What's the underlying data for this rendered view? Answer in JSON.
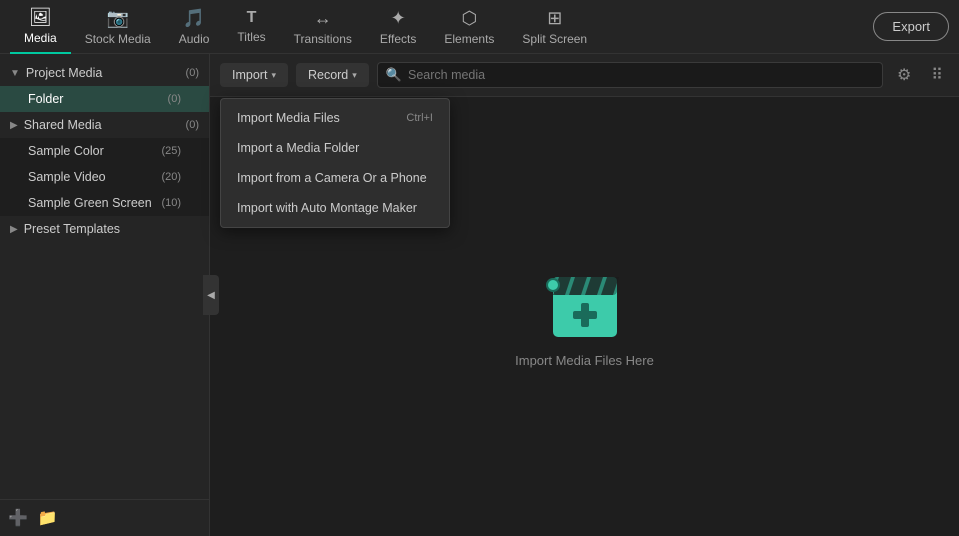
{
  "topNav": {
    "items": [
      {
        "id": "media",
        "label": "Media",
        "icon": "🖼",
        "active": true
      },
      {
        "id": "stock-media",
        "label": "Stock Media",
        "icon": "📷"
      },
      {
        "id": "audio",
        "label": "Audio",
        "icon": "🎵"
      },
      {
        "id": "titles",
        "label": "Titles",
        "icon": "T"
      },
      {
        "id": "transitions",
        "label": "Transitions",
        "icon": "↔"
      },
      {
        "id": "effects",
        "label": "Effects",
        "icon": "✦"
      },
      {
        "id": "elements",
        "label": "Elements",
        "icon": "⬡"
      },
      {
        "id": "split-screen",
        "label": "Split Screen",
        "icon": "⊞"
      }
    ],
    "export_label": "Export"
  },
  "sidebar": {
    "sections": [
      {
        "id": "project-media",
        "label": "Project Media",
        "count": "(0)",
        "expanded": true,
        "children": [
          {
            "id": "folder",
            "label": "Folder",
            "count": "(0)",
            "selected": true
          }
        ]
      },
      {
        "id": "shared-media",
        "label": "Shared Media",
        "count": "(0)",
        "expanded": false,
        "children": []
      },
      {
        "id": "sample-color",
        "label": "Sample Color",
        "count": "(25)",
        "indent": true
      },
      {
        "id": "sample-video",
        "label": "Sample Video",
        "count": "(20)",
        "indent": true
      },
      {
        "id": "sample-green-screen",
        "label": "Sample Green Screen",
        "count": "(10)",
        "indent": true
      },
      {
        "id": "preset-templates",
        "label": "Preset Templates",
        "count": "",
        "expanded": false,
        "children": []
      }
    ],
    "bottom_buttons": [
      "➕",
      "📁"
    ]
  },
  "toolbar": {
    "import_label": "Import",
    "record_label": "Record",
    "search_placeholder": "Search media"
  },
  "dropdown": {
    "items": [
      {
        "id": "import-files",
        "label": "Import Media Files",
        "shortcut": "Ctrl+I"
      },
      {
        "id": "import-folder",
        "label": "Import a Media Folder",
        "shortcut": ""
      },
      {
        "id": "import-camera",
        "label": "Import from a Camera Or a Phone",
        "shortcut": ""
      },
      {
        "id": "import-montage",
        "label": "Import with Auto Montage Maker",
        "shortcut": ""
      }
    ]
  },
  "mediaArea": {
    "placeholder_text": "Import Media Files Here"
  }
}
